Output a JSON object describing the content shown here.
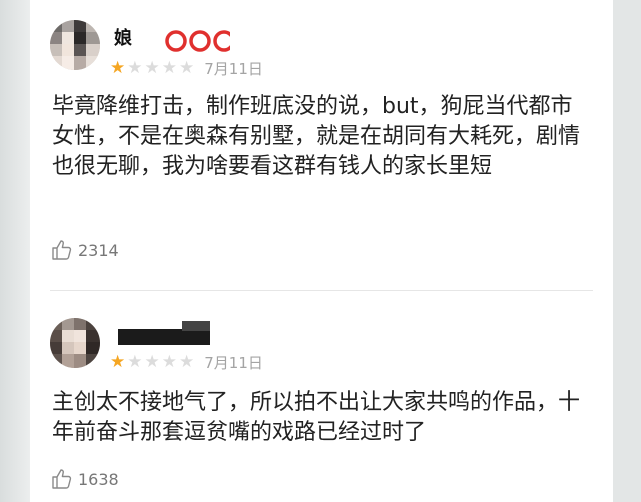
{
  "reviews": [
    {
      "username": "娘",
      "stars_filled": 1,
      "stars_total": 5,
      "date": "7月11日",
      "content": "毕竟降维打击，制作班底没的说，but，狗屁当代都市女性，不是在奥森有别墅，就是在胡同有大耗死，剧情也很无聊，我为啥要看这群有钱人的家长里短",
      "likes": "2314"
    },
    {
      "username": "",
      "stars_filled": 1,
      "stars_total": 5,
      "date": "7月11日",
      "content": "主创太不接地气了，所以拍不出让大家共鸣的作品，十年前奋斗那套逗贫嘴的戏路已经过时了",
      "likes": "1638"
    }
  ],
  "icons": {
    "star": "star-icon",
    "like": "thumbs-up-icon"
  },
  "colors": {
    "star_on": "#f5a623",
    "star_off": "#dcdcdc",
    "badge_red": "#e0302e"
  }
}
